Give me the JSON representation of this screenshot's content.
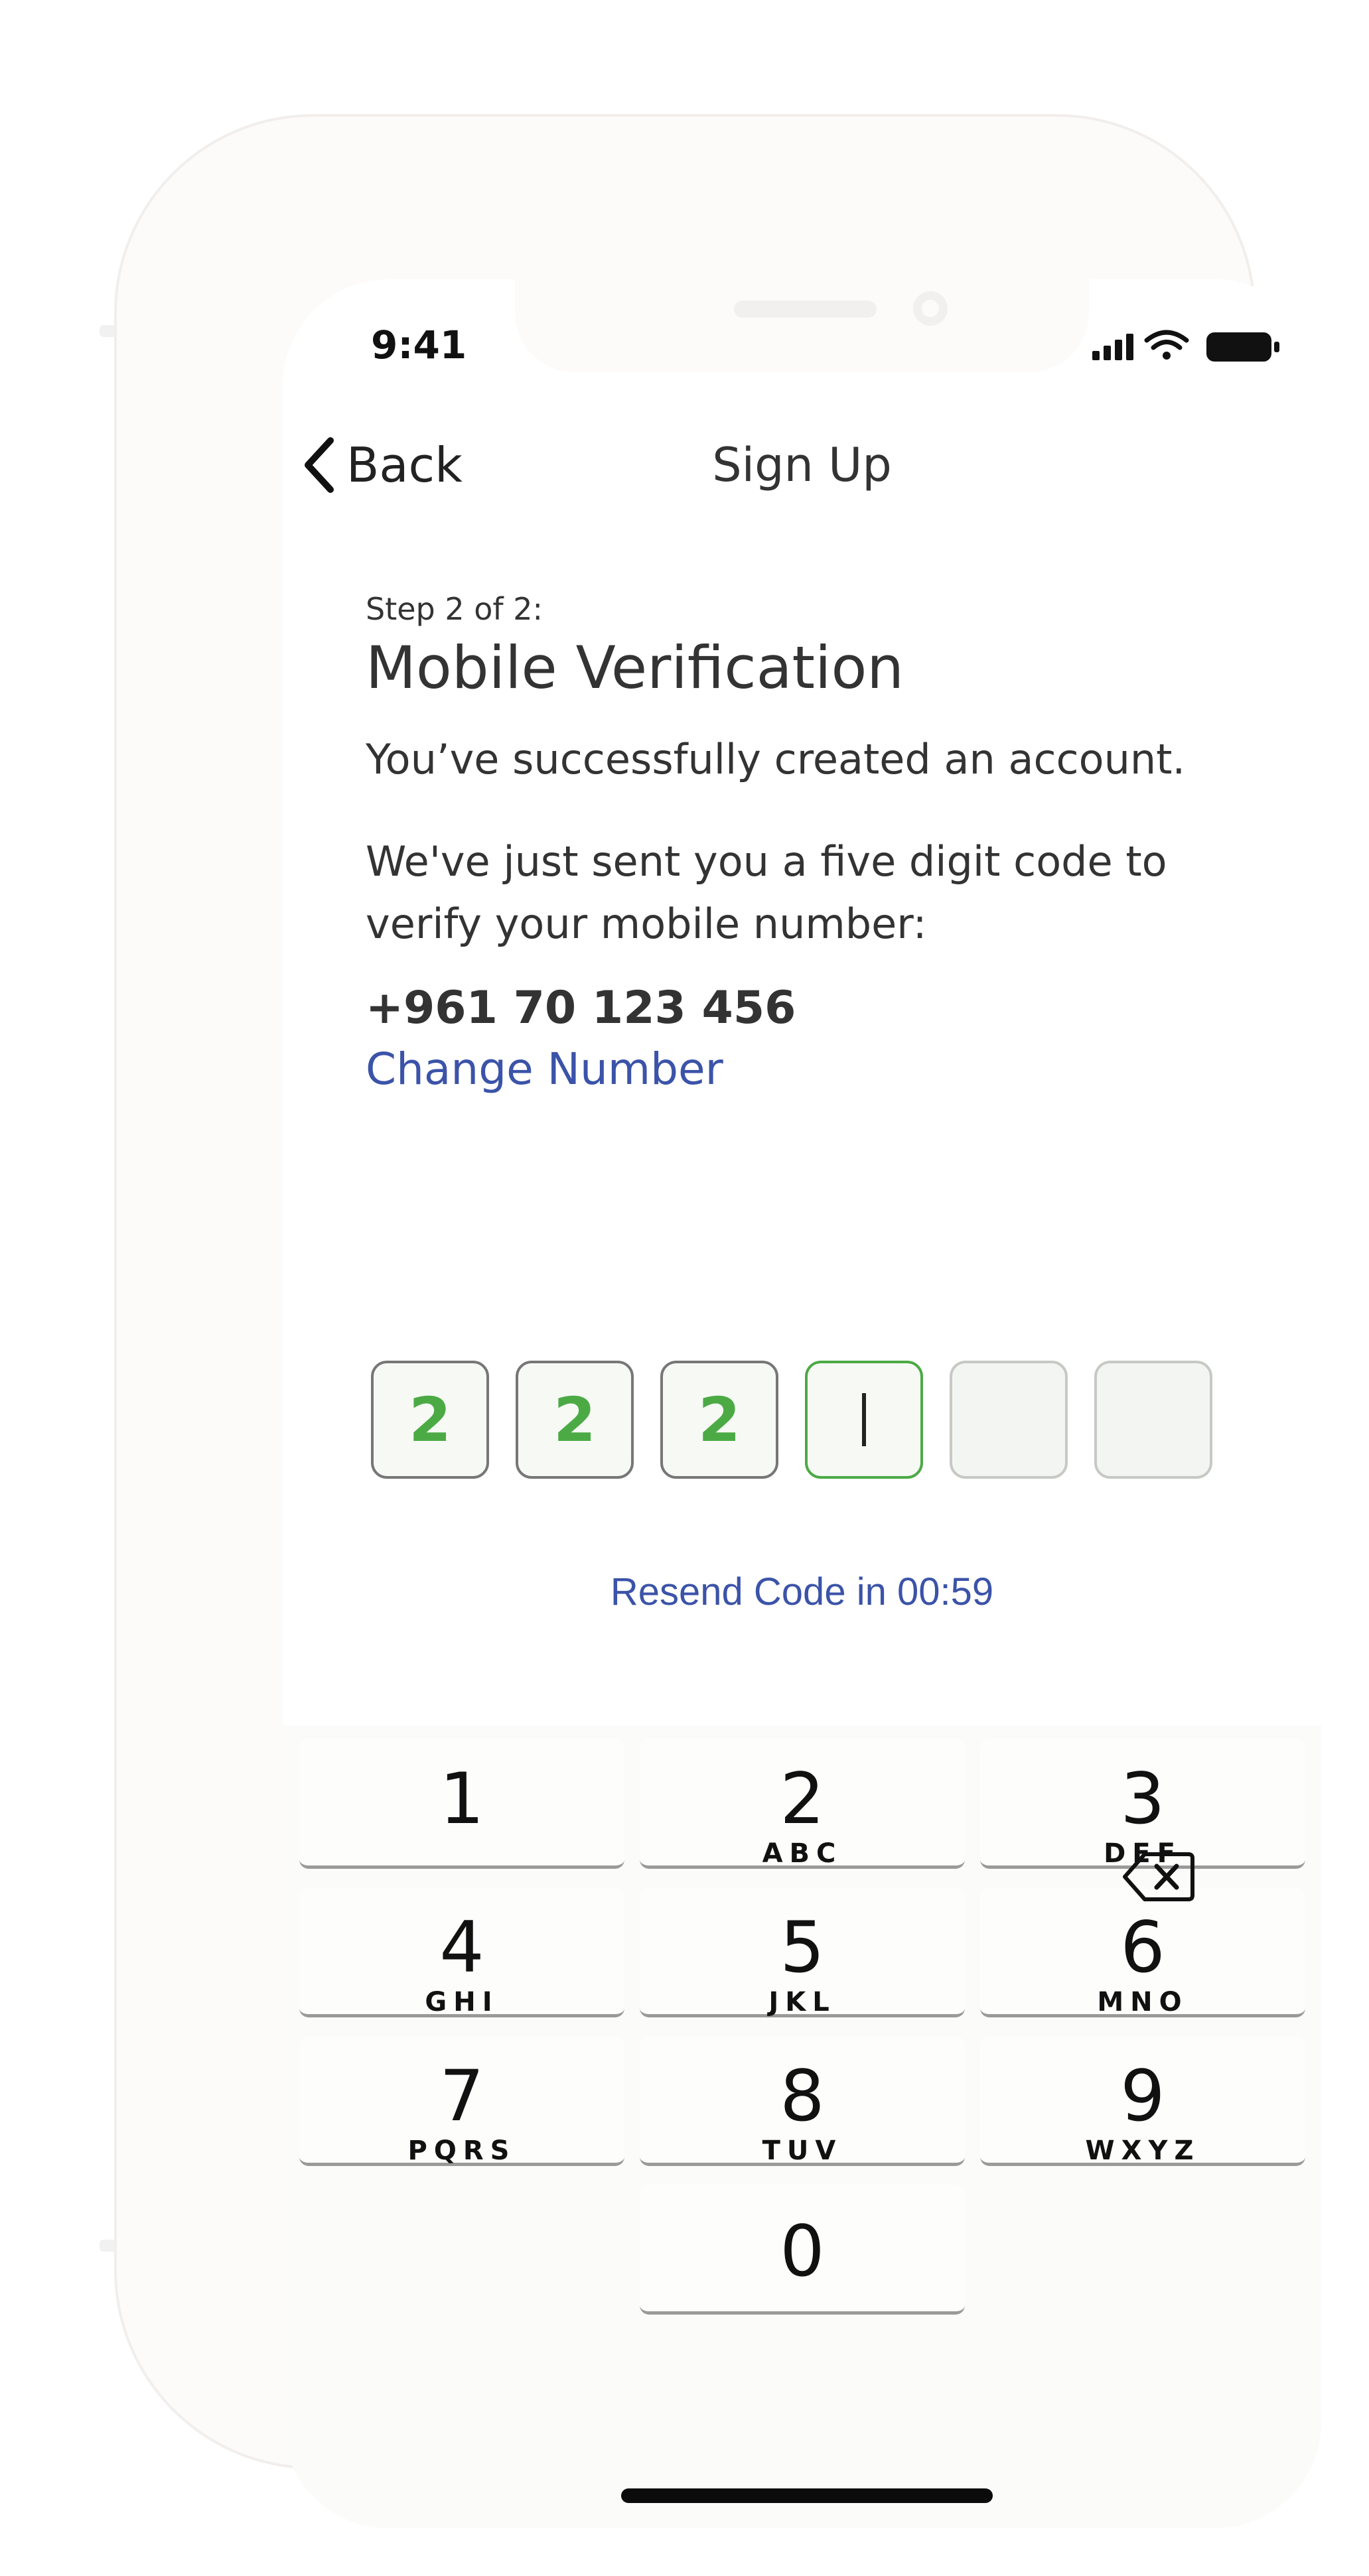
{
  "status_bar": {
    "time": "9:41"
  },
  "nav": {
    "back_label": "Back",
    "title": "Sign Up"
  },
  "content": {
    "step": "Step 2 of 2:",
    "heading": "Mobile Verification",
    "success_text": "You’ve successfully created an account.",
    "sent_text": "We've just sent you a five digit code to verify your mobile number:",
    "phone_number": "+961 70 123 456",
    "change_number": "Change Number"
  },
  "code": {
    "digits": [
      "2",
      "2",
      "2"
    ],
    "total_boxes": 6
  },
  "resend": "Resend Code in 00:59",
  "keypad": {
    "keys": [
      {
        "num": "1",
        "letters": ""
      },
      {
        "num": "2",
        "letters": "ABC"
      },
      {
        "num": "3",
        "letters": "DEF"
      },
      {
        "num": "4",
        "letters": "GHI"
      },
      {
        "num": "5",
        "letters": "JKL"
      },
      {
        "num": "6",
        "letters": "MNO"
      },
      {
        "num": "7",
        "letters": "PQRS"
      },
      {
        "num": "8",
        "letters": "TUV"
      },
      {
        "num": "9",
        "letters": "WXYZ"
      },
      {
        "num": "0",
        "letters": ""
      }
    ],
    "backspace_icon": "backspace-icon"
  },
  "colors": {
    "accent_green": "#4caa45",
    "link_blue": "#3b53a8",
    "text": "#333333"
  }
}
